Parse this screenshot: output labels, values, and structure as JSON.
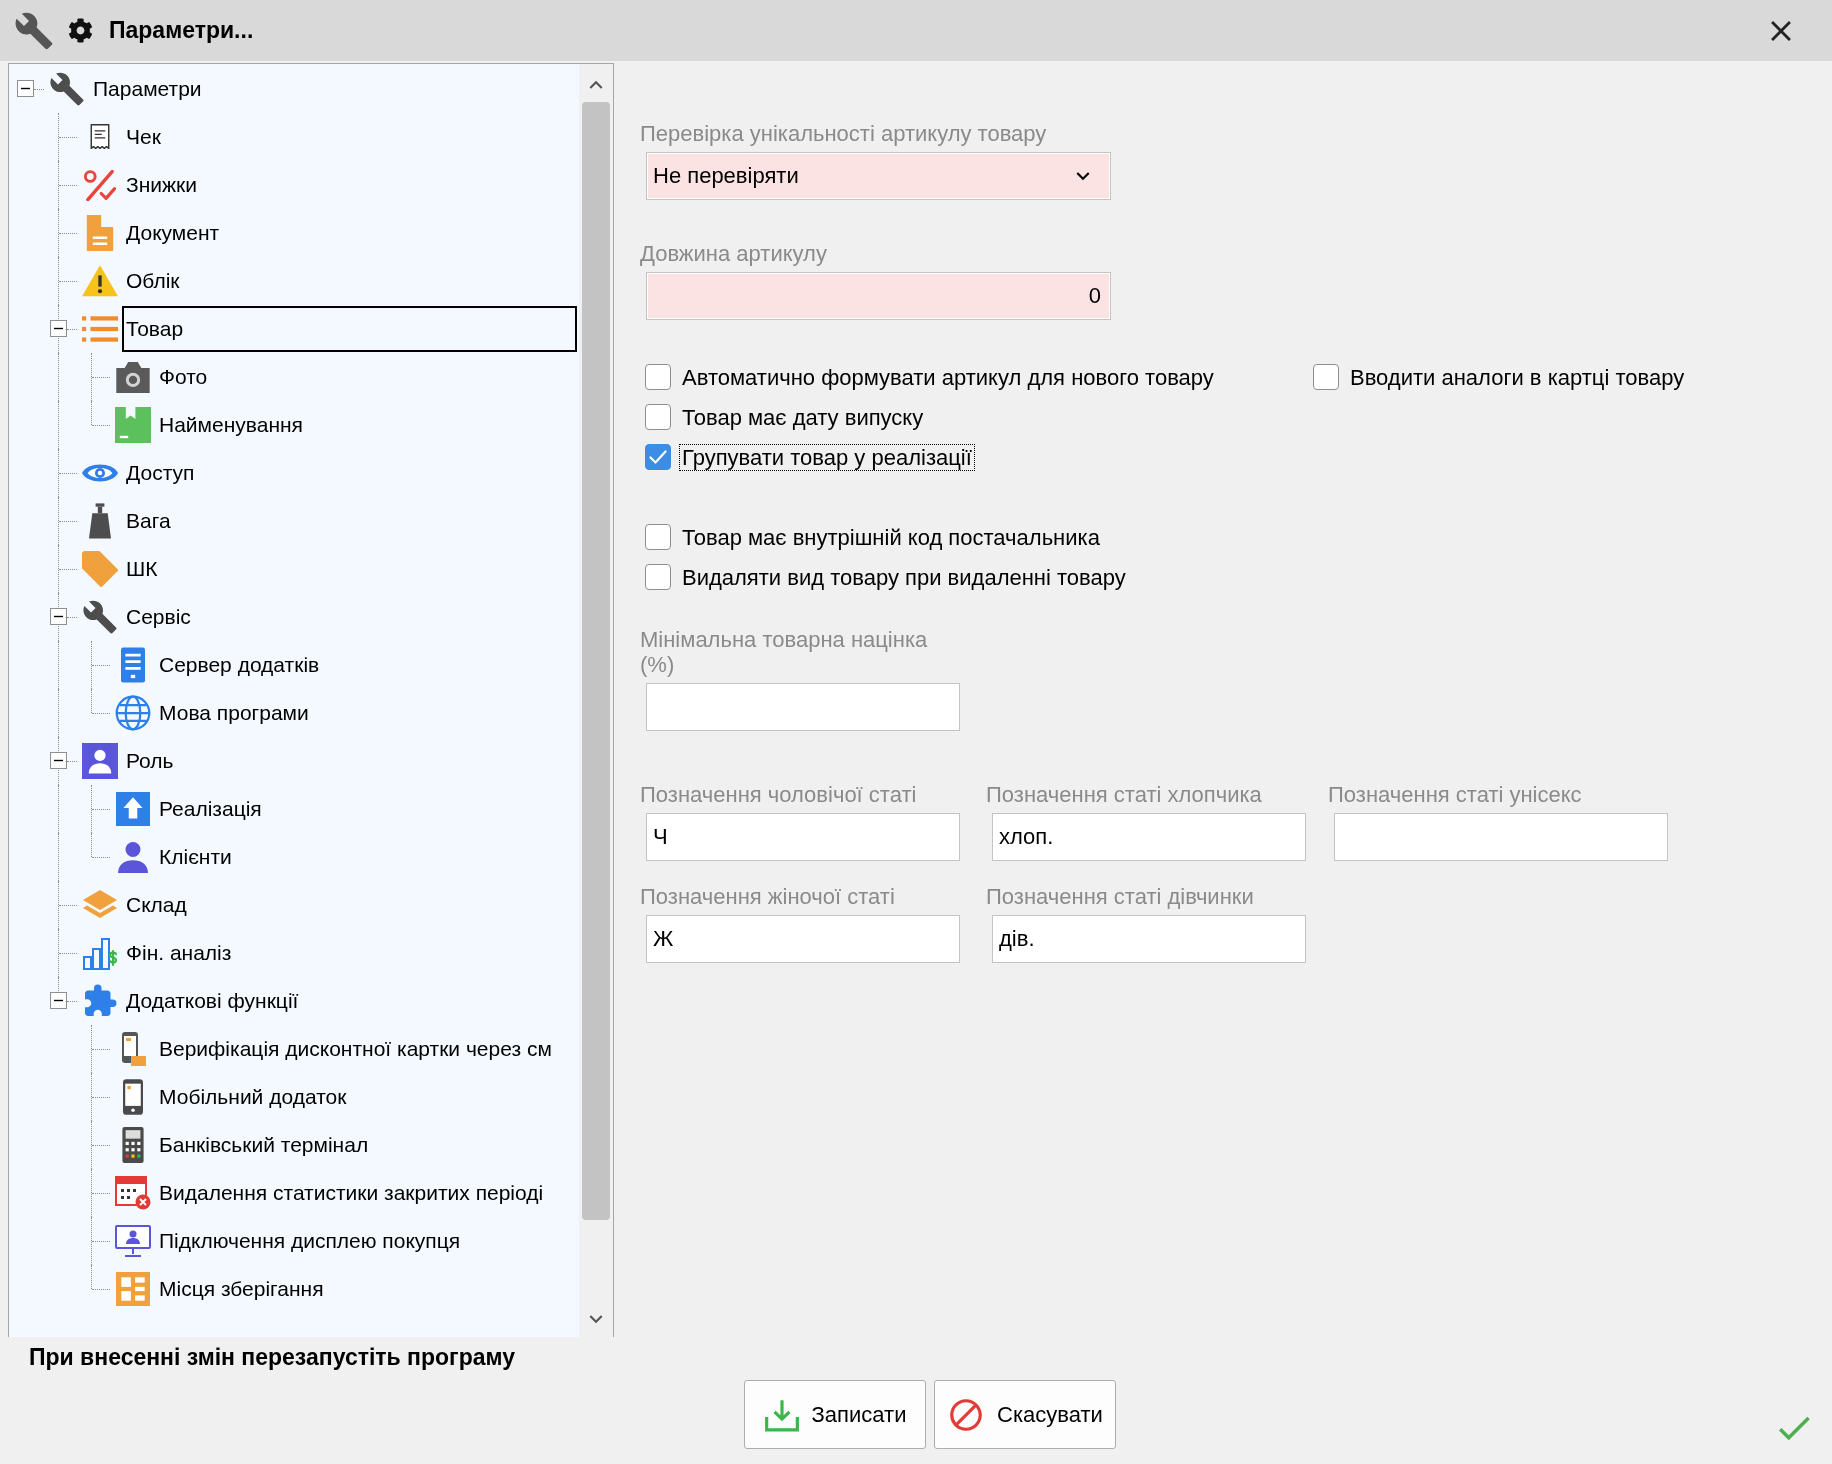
{
  "window": {
    "title": "Параметри..."
  },
  "tree": [
    {
      "label": "Параметри",
      "selected": false,
      "expanded": true,
      "children": [
        {
          "label": "Чек",
          "selected": false
        },
        {
          "label": "Знижки",
          "selected": false
        },
        {
          "label": "Документ",
          "selected": false
        },
        {
          "label": "Облік",
          "selected": false
        },
        {
          "label": "Товар",
          "selected": true,
          "expanded": true,
          "children": [
            {
              "label": "Фото",
              "selected": false
            },
            {
              "label": "Найменування",
              "selected": false
            }
          ]
        },
        {
          "label": "Доступ",
          "selected": false
        },
        {
          "label": "Вага",
          "selected": false
        },
        {
          "label": "ШК",
          "selected": false
        },
        {
          "label": "Сервіс",
          "selected": false,
          "expanded": true,
          "children": [
            {
              "label": "Сервер додатків",
              "selected": false
            },
            {
              "label": "Мова програми",
              "selected": false
            }
          ]
        },
        {
          "label": "Роль",
          "selected": false,
          "expanded": true,
          "children": [
            {
              "label": "Реалізація",
              "selected": false
            },
            {
              "label": "Клієнти",
              "selected": false
            }
          ]
        },
        {
          "label": "Склад",
          "selected": false
        },
        {
          "label": "Фін. аналіз",
          "selected": false
        },
        {
          "label": "Додаткові функції",
          "selected": false,
          "expanded": true,
          "children": [
            {
              "label": "Верифікація дисконтної картки через см",
              "selected": false
            },
            {
              "label": "Мобільний додаток",
              "selected": false
            },
            {
              "label": "Банківський термінал",
              "selected": false
            },
            {
              "label": "Видалення статистики закритих періоді",
              "selected": false
            },
            {
              "label": "Підключення дисплею покупця",
              "selected": false
            },
            {
              "label": "Місця зберігання",
              "selected": false
            }
          ]
        }
      ]
    }
  ],
  "form": {
    "uniqueness_check": {
      "label": "Перевірка унікальності артикулу товару",
      "value": "Не перевіряти",
      "highlighted": true
    },
    "code_length": {
      "label": "Довжина артикулу",
      "value": "0",
      "highlighted": true
    },
    "checkbox_groups": [
      {
        "rows": [
          {
            "items": [
              {
                "label": "Автоматично формувати артикул для нового товару",
                "checked": false,
                "focused": false
              },
              {
                "label": "Вводити аналоги в картці товару",
                "checked": false,
                "focused": false
              }
            ]
          },
          {
            "items": [
              {
                "label": "Товар має дату випуску",
                "checked": false,
                "focused": false
              }
            ]
          },
          {
            "items": [
              {
                "label": "Групувати товар у реалізації",
                "checked": true,
                "focused": true
              }
            ]
          }
        ]
      },
      {
        "rows": [
          {
            "items": [
              {
                "label": "Товар має внутрішній код постачальника",
                "checked": false,
                "focused": false
              }
            ]
          },
          {
            "items": [
              {
                "label": "Видаляти вид товару при видаленні товару",
                "checked": false,
                "focused": false
              }
            ]
          }
        ]
      }
    ],
    "min_markup": {
      "label": "Мінімальна товарна націнка (%)",
      "highlighted": false
    },
    "gender_fields": [
      {
        "fields": [
          {
            "label": "Позначення чоловічої статі",
            "value": "Ч",
            "highlighted": false
          },
          {
            "label": "Позначення статі хлопчика",
            "value": "хлоп.",
            "highlighted": false
          },
          {
            "label": "Позначення статі унісекс",
            "highlighted": false
          }
        ]
      },
      {
        "fields": [
          {
            "label": "Позначення жіночої статі",
            "value": "Ж",
            "highlighted": false
          },
          {
            "label": "Позначення статі дівчинки",
            "value": "дів.",
            "highlighted": false
          }
        ]
      }
    ]
  },
  "status_text": "При внесенні змін перезапустіть програму",
  "buttons": [
    {
      "label": "Записати",
      "kind": "save"
    },
    {
      "label": "Скасувати",
      "kind": "cancel"
    }
  ]
}
